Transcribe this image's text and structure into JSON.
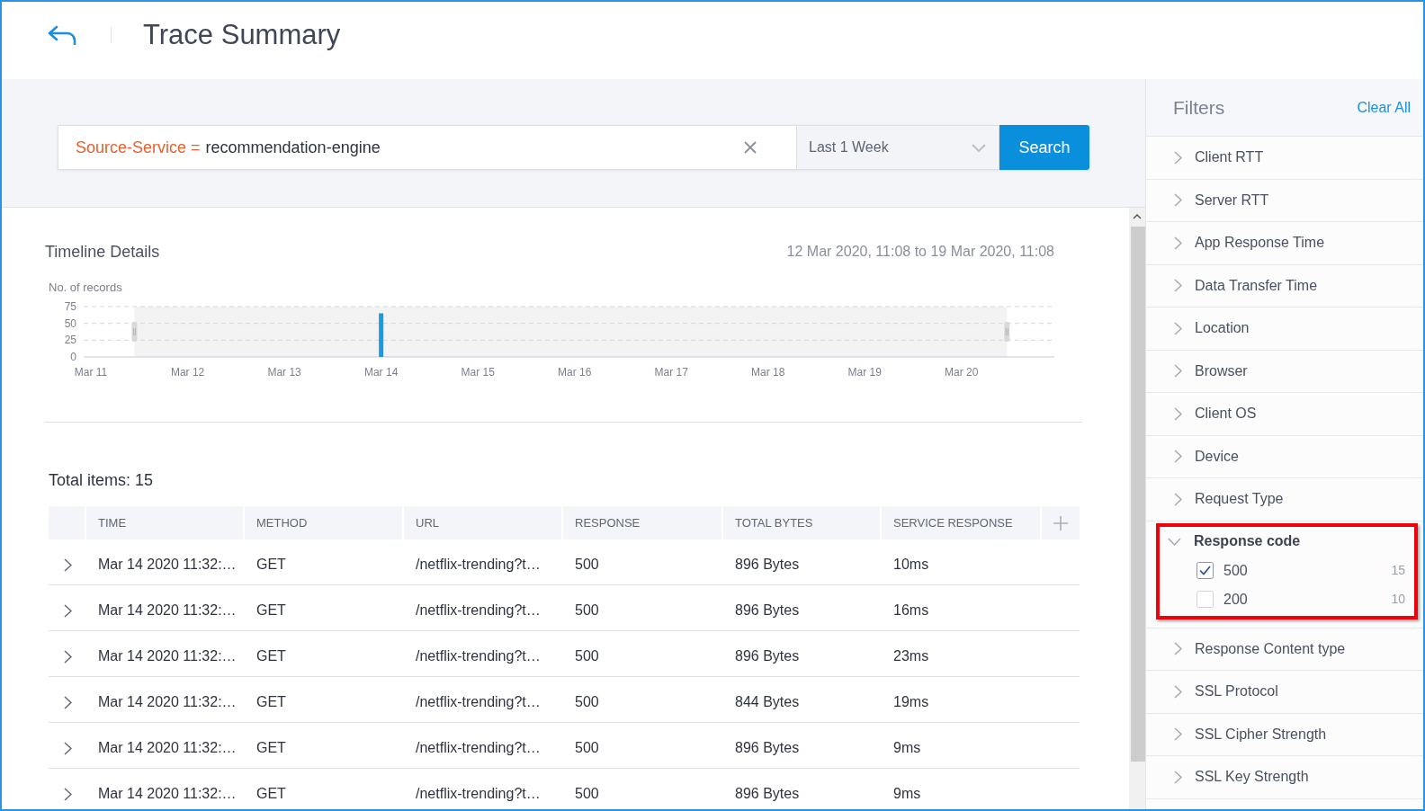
{
  "header": {
    "title": "Trace Summary"
  },
  "search": {
    "key": "Source-Service =",
    "value": "recommendation-engine",
    "time_range": "Last 1 Week",
    "button": "Search"
  },
  "timeline": {
    "title": "Timeline Details",
    "range": "12 Mar 2020, 11:08 to 19 Mar 2020, 11:08",
    "chart_data": {
      "type": "bar",
      "ylabel": "No. of records",
      "categories": [
        "Mar 11",
        "Mar 12",
        "Mar 13",
        "Mar 14",
        "Mar 15",
        "Mar 16",
        "Mar 17",
        "Mar 18",
        "Mar 19",
        "Mar 20"
      ],
      "values": [
        null,
        null,
        null,
        65,
        null,
        null,
        null,
        null,
        null,
        null
      ],
      "ylim": [
        0,
        75
      ],
      "yticks": [
        0,
        25,
        50,
        75
      ]
    }
  },
  "table": {
    "total": "Total items: 15",
    "columns": [
      "TIME",
      "METHOD",
      "URL",
      "RESPONSE",
      "TOTAL BYTES",
      "SERVICE RESPONSE"
    ],
    "rows": [
      [
        "Mar 14 2020 11:32:…",
        "GET",
        "/netflix-trending?t…",
        "500",
        "896 Bytes",
        "10ms"
      ],
      [
        "Mar 14 2020 11:32:…",
        "GET",
        "/netflix-trending?t…",
        "500",
        "896 Bytes",
        "16ms"
      ],
      [
        "Mar 14 2020 11:32:…",
        "GET",
        "/netflix-trending?t…",
        "500",
        "896 Bytes",
        "23ms"
      ],
      [
        "Mar 14 2020 11:32:…",
        "GET",
        "/netflix-trending?t…",
        "500",
        "844 Bytes",
        "19ms"
      ],
      [
        "Mar 14 2020 11:32:…",
        "GET",
        "/netflix-trending?t…",
        "500",
        "896 Bytes",
        "9ms"
      ],
      [
        "Mar 14 2020 11:32:…",
        "GET",
        "/netflix-trending?t…",
        "500",
        "896 Bytes",
        "9ms"
      ]
    ]
  },
  "filters": {
    "title": "Filters",
    "clear": "Clear All",
    "items": [
      {
        "label": "Client RTT",
        "expanded": false,
        "highlighted": false
      },
      {
        "label": "Server RTT",
        "expanded": false,
        "highlighted": false
      },
      {
        "label": "App Response Time",
        "expanded": false,
        "highlighted": false
      },
      {
        "label": "Data Transfer Time",
        "expanded": false,
        "highlighted": false
      },
      {
        "label": "Location",
        "expanded": false,
        "highlighted": false
      },
      {
        "label": "Browser",
        "expanded": false,
        "highlighted": false
      },
      {
        "label": "Client OS",
        "expanded": false,
        "highlighted": false
      },
      {
        "label": "Device",
        "expanded": false,
        "highlighted": false
      },
      {
        "label": "Request Type",
        "expanded": false,
        "highlighted": false
      },
      {
        "label": "Response code",
        "expanded": true,
        "highlighted": true,
        "options": [
          {
            "label": "500",
            "count": "15",
            "checked": true
          },
          {
            "label": "200",
            "count": "10",
            "checked": false
          }
        ]
      },
      {
        "label": "Response Content type",
        "expanded": false,
        "highlighted": false
      },
      {
        "label": "SSL Protocol",
        "expanded": false,
        "highlighted": false
      },
      {
        "label": "SSL Cipher Strength",
        "expanded": false,
        "highlighted": false
      },
      {
        "label": "SSL Key Strength",
        "expanded": false,
        "highlighted": false
      }
    ]
  }
}
